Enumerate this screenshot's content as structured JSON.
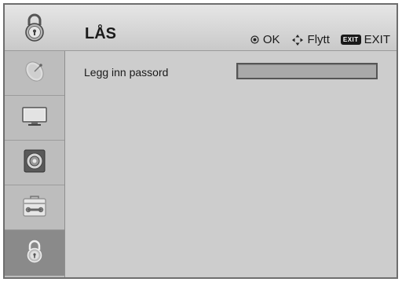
{
  "header": {
    "title": "LÅS",
    "icon": "lock-icon",
    "hints": [
      {
        "icon": "ok-circle-icon",
        "label": "OK"
      },
      {
        "icon": "move-arrows-icon",
        "label": "Flytt"
      },
      {
        "icon": "exit-key-icon",
        "badge": "EXIT",
        "label": "EXIT"
      }
    ]
  },
  "sidebar": {
    "items": [
      {
        "icon": "satellite-dish-icon",
        "active": false
      },
      {
        "icon": "tv-screen-icon",
        "active": false
      },
      {
        "icon": "speaker-icon",
        "active": false
      },
      {
        "icon": "toolbox-icon",
        "active": false
      },
      {
        "icon": "lock-icon",
        "active": true
      }
    ]
  },
  "main": {
    "password_label": "Legg inn passord",
    "password_value": ""
  },
  "colors": {
    "frame_bg": "#cdcdcd",
    "sidebar_bg": "#bdbdbd",
    "active_item": "#8a8a8a",
    "input_bg": "#a9a9a9"
  }
}
